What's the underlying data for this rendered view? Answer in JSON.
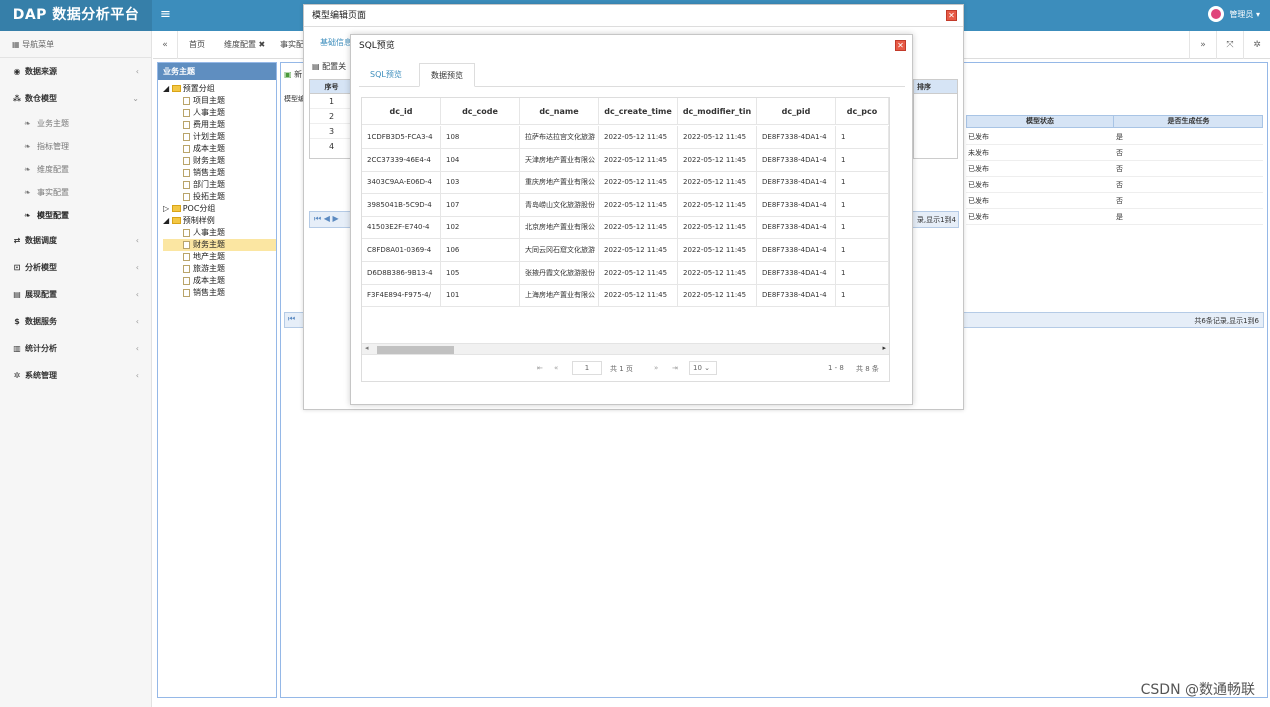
{
  "app": {
    "brand": "DAP 数据分析平台",
    "menu_icon": "hamburger-icon",
    "user": "管理员 ▾"
  },
  "sidebar": {
    "header": "导航菜单",
    "items": [
      {
        "label": "数据来源",
        "icon": "database-icon"
      },
      {
        "label": "数仓模型",
        "icon": "cubes-icon"
      },
      {
        "label": "数据调度",
        "icon": "shuffle-icon"
      },
      {
        "label": "分析模型",
        "icon": "sitemap-icon"
      },
      {
        "label": "展现配置",
        "icon": "film-icon"
      },
      {
        "label": "数据服务",
        "icon": "dollar-icon"
      },
      {
        "label": "统计分析",
        "icon": "bar-chart-icon"
      },
      {
        "label": "系统管理",
        "icon": "gear-icon"
      }
    ],
    "subitems": [
      "业务主题",
      "指标管理",
      "维度配置",
      "事实配置",
      "模型配置"
    ]
  },
  "tabs": {
    "items": [
      "首页",
      "维度配置 ✖",
      "事实配"
    ]
  },
  "tree": {
    "title": "业务主题",
    "group1": "预置分组",
    "g1_items": [
      "项目主题",
      "人事主题",
      "费用主题",
      "计划主题",
      "成本主题",
      "财务主题",
      "销售主题",
      "部门主题",
      "投拓主题"
    ],
    "group2": "POC分组",
    "group3": "预制样例",
    "g3_items": [
      "人事主题",
      "财务主题",
      "地产主题",
      "旅游主题",
      "成本主题",
      "销售主题"
    ]
  },
  "model_area": {
    "new_btn": "新",
    "config_label": "配置关",
    "model_label": "模型编",
    "seq_header": "序号",
    "seq": [
      "1",
      "2",
      "3",
      "4"
    ],
    "sort_header": "排序",
    "pager_text": "录,显示1到4",
    "status_header": "模型状态",
    "task_header": "是否生成任务",
    "rows": [
      [
        "已发布",
        "是"
      ],
      [
        "未发布",
        "否"
      ],
      [
        "已发布",
        "否"
      ],
      [
        "已发布",
        "否"
      ],
      [
        "已发布",
        "否"
      ],
      [
        "已发布",
        "是"
      ]
    ],
    "footer": "共6条记录,显示1到6"
  },
  "dialog1": {
    "title": "模型编辑页面",
    "tab": "基础信息"
  },
  "dialog2": {
    "title": "SQL预览",
    "tab_sql": "SQL预览",
    "tab_data": "数据预览",
    "columns": [
      "dc_id",
      "dc_code",
      "dc_name",
      "dc_create_time",
      "dc_modifier_tin",
      "dc_pid",
      "dc_pco"
    ],
    "rows": [
      [
        "1CDFB3D5-FCA3-4",
        "108",
        "拉萨布达拉宫文化旅游",
        "2022-05-12 11:45",
        "2022-05-12 11:45",
        "DE8F7338-4DA1-4",
        "1"
      ],
      [
        "2CC37339-46E4-4",
        "104",
        "天津房地产置业有限公",
        "2022-05-12 11:45",
        "2022-05-12 11:45",
        "DE8F7338-4DA1-4",
        "1"
      ],
      [
        "3403C9AA-E06D-4",
        "103",
        "重庆房地产置业有限公",
        "2022-05-12 11:45",
        "2022-05-12 11:45",
        "DE8F7338-4DA1-4",
        "1"
      ],
      [
        "3985041B-5C9D-4",
        "107",
        "青岛崂山文化旅游股份",
        "2022-05-12 11:45",
        "2022-05-12 11:45",
        "DE8F7338-4DA1-4",
        "1"
      ],
      [
        "41503E2F-E740-4",
        "102",
        "北京房地产置业有限公",
        "2022-05-12 11:45",
        "2022-05-12 11:45",
        "DE8F7338-4DA1-4",
        "1"
      ],
      [
        "C8FD8A01-0369-4",
        "106",
        "大同云冈石窟文化旅游",
        "2022-05-12 11:45",
        "2022-05-12 11:45",
        "DE8F7338-4DA1-4",
        "1"
      ],
      [
        "D6D8B386-9B13-4",
        "105",
        "张掖丹霞文化旅游股份",
        "2022-05-12 11:45",
        "2022-05-12 11:45",
        "DE8F7338-4DA1-4",
        "1"
      ],
      [
        "F3F4E894-F975-4/",
        "101",
        "上海房地产置业有限公",
        "2022-05-12 11:45",
        "2022-05-12 11:45",
        "DE8F7338-4DA1-4",
        "1"
      ]
    ],
    "pager": {
      "page": "1",
      "total_pages": "共 1 页",
      "page_size": "10",
      "range": "1 - 8",
      "total": "共 8 条"
    }
  },
  "credit": "CSDN @数通畅联"
}
